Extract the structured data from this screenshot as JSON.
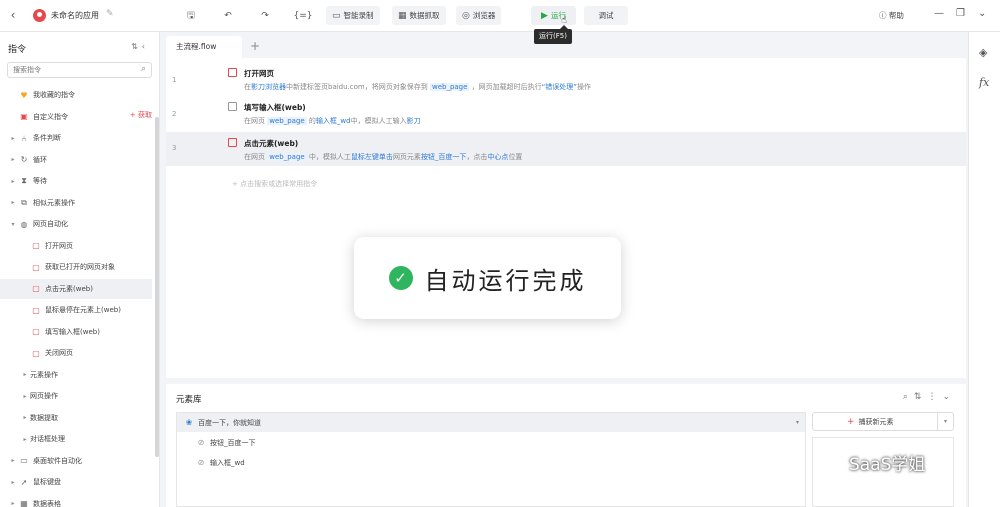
{
  "titlebar": {
    "back_icon": "back-chevron-icon",
    "app_name": "未命名的应用",
    "toolbar": {
      "smart_record": "智能录制",
      "data_capture": "数据抓取",
      "browser": "浏览器",
      "run": "运行",
      "debug": "调试",
      "help": "帮助"
    },
    "run_tooltip": "运行(F5)"
  },
  "left_panel": {
    "title": "指令",
    "search_placeholder": "搜索指令",
    "get_link": "+ 获取",
    "items": [
      {
        "label": "我收藏的指令",
        "icon": "heart-icon",
        "level": 0
      },
      {
        "label": "自定义指令",
        "icon": "custom-icon",
        "level": 0
      },
      {
        "label": "条件判断",
        "icon": "branch-icon",
        "level": 0
      },
      {
        "label": "循环",
        "icon": "loop-icon",
        "level": 0
      },
      {
        "label": "等待",
        "icon": "hourglass-icon",
        "level": 0
      },
      {
        "label": "相似元素操作",
        "icon": "copy-icon",
        "level": 0
      },
      {
        "label": "网页自动化",
        "icon": "globe-icon",
        "level": 0
      },
      {
        "label": "打开网页",
        "icon": "page-icon",
        "level": 1
      },
      {
        "label": "获取已打开的网页对象",
        "icon": "page-icon",
        "level": 1
      },
      {
        "label": "点击元素(web)",
        "icon": "page-icon",
        "level": 1
      },
      {
        "label": "鼠标悬停在元素上(web)",
        "icon": "page-icon",
        "level": 1
      },
      {
        "label": "填写输入框(web)",
        "icon": "page-icon",
        "level": 1
      },
      {
        "label": "关闭网页",
        "icon": "page-icon",
        "level": 1
      },
      {
        "label": "元素操作",
        "icon": "",
        "level": 1
      },
      {
        "label": "网页操作",
        "icon": "",
        "level": 1
      },
      {
        "label": "数据提取",
        "icon": "",
        "level": 1
      },
      {
        "label": "对话框处理",
        "icon": "",
        "level": 1
      },
      {
        "label": "桌面软件自动化",
        "icon": "monitor-icon",
        "level": 0
      },
      {
        "label": "鼠标键盘",
        "icon": "cursor-icon",
        "level": 0
      },
      {
        "label": "数据表格",
        "icon": "table-icon",
        "level": 0
      }
    ]
  },
  "editor": {
    "tab": "主流程.flow",
    "steps": [
      {
        "num": "1",
        "title": "打开网页",
        "desc_parts": [
          {
            "t": "在",
            "s": ""
          },
          {
            "t": "影刀浏览器",
            "s": "k"
          },
          {
            "t": "中新建标签页baidu.com，将网页对象保存到 ",
            "s": ""
          },
          {
            "t": "web_page",
            "s": "v"
          },
          {
            "t": " ，网页加载超时后执行",
            "s": ""
          },
          {
            "t": "“错误处理”",
            "s": "k"
          },
          {
            "t": "操作",
            "s": ""
          }
        ]
      },
      {
        "num": "2",
        "title": "填写输入框(web)",
        "desc_parts": [
          {
            "t": "在网页 ",
            "s": ""
          },
          {
            "t": "web_page",
            "s": "v"
          },
          {
            "t": " 的",
            "s": ""
          },
          {
            "t": "输入框_wd",
            "s": "k"
          },
          {
            "t": "中，模拟人工输入",
            "s": ""
          },
          {
            "t": "影刀",
            "s": "k"
          }
        ]
      },
      {
        "num": "3",
        "title": "点击元素(web)",
        "desc_parts": [
          {
            "t": "在网页 ",
            "s": ""
          },
          {
            "t": "web_page",
            "s": "v"
          },
          {
            "t": " 中，模拟人工",
            "s": ""
          },
          {
            "t": "鼠标左键单击",
            "s": "k"
          },
          {
            "t": "网页元素",
            "s": ""
          },
          {
            "t": "按钮_百度一下",
            "s": "k"
          },
          {
            "t": "，点击",
            "s": ""
          },
          {
            "t": "中心点",
            "s": "k"
          },
          {
            "t": "位置",
            "s": ""
          }
        ]
      }
    ],
    "add_hint": "+ 点击搜索或选择常用指令"
  },
  "toast": {
    "message": "自动运行完成"
  },
  "element_library": {
    "title": "元素库",
    "group": "百度一下，你就知道",
    "items": [
      "按钮_百度一下",
      "输入框_wd"
    ],
    "capture_button": "捕获新元素"
  },
  "watermark": "SaaS学姐"
}
